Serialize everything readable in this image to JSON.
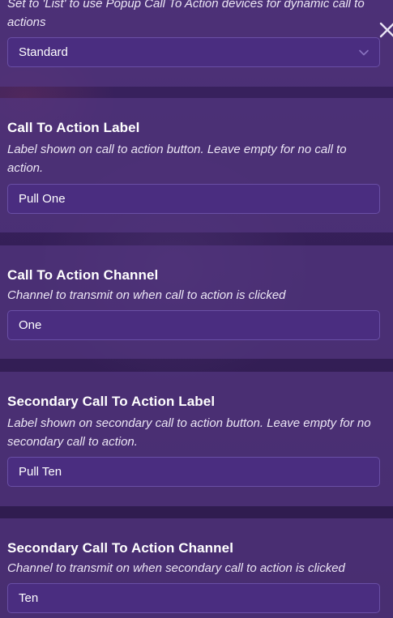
{
  "sections": [
    {
      "description": "Set to 'List' to use Popup Call To Action devices for dynamic call to actions",
      "value": "Standard"
    },
    {
      "title": "Call To Action Label",
      "description": "Label shown on call to action button. Leave empty for no call to action.",
      "value": "Pull One"
    },
    {
      "title": "Call To Action Channel",
      "description": "Channel to transmit on when call to action is clicked",
      "value": "One"
    },
    {
      "title": "Secondary Call To Action Label",
      "description": "Label shown on secondary call to action button. Leave empty for no secondary call to action.",
      "value": "Pull Ten"
    },
    {
      "title": "Secondary Call To Action Channel",
      "description": "Channel to transmit on when secondary call to action is clicked",
      "value": "Ten"
    }
  ],
  "icons": {
    "close": "close-icon",
    "dropdown": "chevron-down-icon"
  },
  "colors": {
    "panel": "#533680",
    "field": "#4a2d80",
    "field_border": "#6a4fa6"
  }
}
